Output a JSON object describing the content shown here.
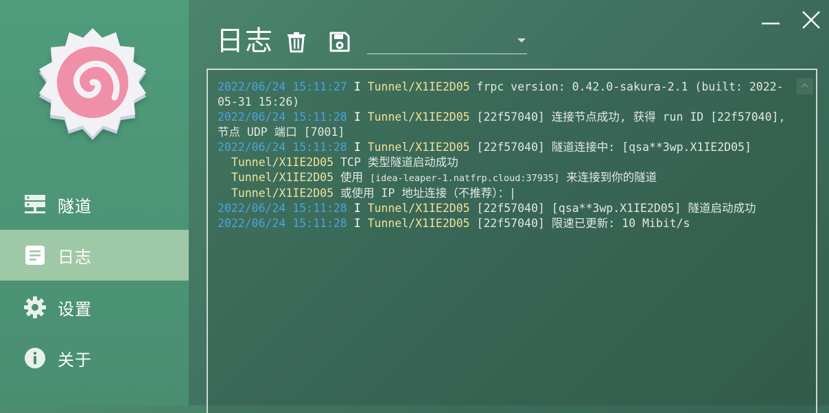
{
  "sidebar": {
    "items": [
      {
        "label": "隧道",
        "icon": "server-icon",
        "active": false
      },
      {
        "label": "日志",
        "icon": "document-icon",
        "active": true
      },
      {
        "label": "设置",
        "icon": "gear-icon",
        "active": false
      },
      {
        "label": "关于",
        "icon": "info-icon",
        "active": false
      }
    ]
  },
  "header": {
    "title": "日志",
    "selector_value": ""
  },
  "colors": {
    "timestamp": "#4aa3e0",
    "tunnel": "#f2e29a",
    "active_nav": "#9fc8a6"
  },
  "log": {
    "lines": [
      {
        "ts": "2022/06/24 15:11:27",
        "lvl": "I",
        "tunnel": "Tunnel/X1IE2D05",
        "msg": "frpc version: 0.42.0-sakura-2.1 (built: 2022-05-31 15:26)"
      },
      {
        "ts": "2022/06/24 15:11:28",
        "lvl": "I",
        "tunnel": "Tunnel/X1IE2D05",
        "msg": "[22f57040] 连接节点成功, 获得 run ID [22f57040], 节点 UDP 端口 [7001]"
      },
      {
        "ts": "2022/06/24 15:11:28",
        "lvl": "I",
        "tunnel": "Tunnel/X1IE2D05",
        "msg": "[22f57040] 隧道连接中: [qsa**3wp.X1IE2D05]"
      }
    ],
    "sub": [
      {
        "tunnel": "Tunnel/X1IE2D05",
        "msg": "TCP 类型隧道启动成功"
      },
      {
        "tunnel": "Tunnel/X1IE2D05",
        "pre": "使用",
        "addr": "[idea-leaper-1.natfrp.cloud:37935]",
        "post": "来连接到你的隧道"
      },
      {
        "tunnel": "Tunnel/X1IE2D05",
        "msg": "或使用 IP 地址连接（不推荐）：|"
      }
    ],
    "tail": [
      {
        "ts": "2022/06/24 15:11:28",
        "lvl": "I",
        "tunnel": "Tunnel/X1IE2D05",
        "msg": "[22f57040] [qsa**3wp.X1IE2D05] 隧道启动成功"
      },
      {
        "ts": "2022/06/24 15:11:28",
        "lvl": "I",
        "tunnel": "Tunnel/X1IE2D05",
        "msg": "[22f57040] 限速已更新: 10 Mibit/s"
      }
    ]
  }
}
